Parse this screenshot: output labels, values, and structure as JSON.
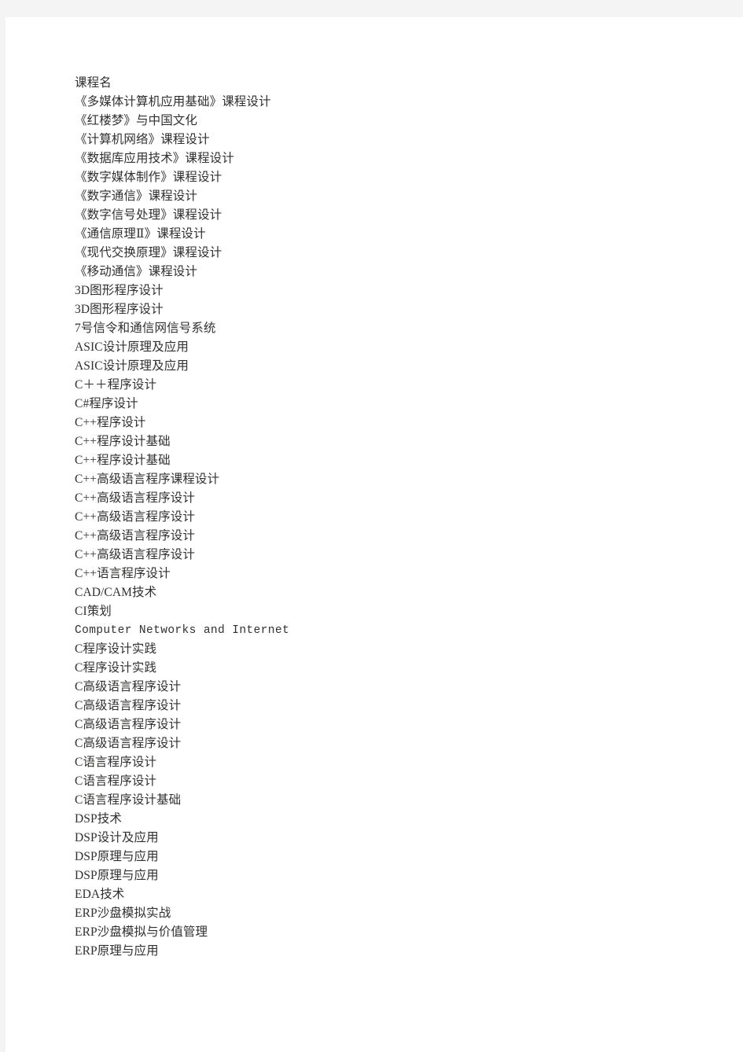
{
  "page": {
    "background_color": "#ffffff",
    "chrome_color": "#f4f4f4",
    "text_color": "#31302f"
  },
  "document": {
    "header": "课程名",
    "lines": [
      "《多媒体计算机应用基础》课程设计",
      "《红楼梦》与中国文化",
      "《计算机网络》课程设计",
      "《数据库应用技术》课程设计",
      "《数字媒体制作》课程设计",
      "《数字通信》课程设计",
      "《数字信号处理》课程设计",
      "《通信原理Ⅱ》课程设计",
      "《现代交换原理》课程设计",
      "《移动通信》课程设计",
      "3D图形程序设计",
      "3D图形程序设计",
      "7号信令和通信网信号系统",
      "ASIC设计原理及应用",
      "ASIC设计原理及应用",
      "C＋＋程序设计",
      "C#程序设计",
      "C++程序设计",
      "C++程序设计基础",
      "C++程序设计基础",
      "C++高级语言程序课程设计",
      "C++高级语言程序设计",
      "C++高级语言程序设计",
      "C++高级语言程序设计",
      "C++高级语言程序设计",
      "C++语言程序设计",
      "CAD/CAM技术",
      "CI策划",
      "Computer Networks and Internet",
      "C程序设计实践",
      "C程序设计实践",
      "C高级语言程序设计",
      "C高级语言程序设计",
      "C高级语言程序设计",
      "C高级语言程序设计",
      "C语言程序设计",
      "C语言程序设计",
      "C语言程序设计基础",
      "DSP技术",
      "DSP设计及应用",
      "DSP原理与应用",
      "DSP原理与应用",
      "EDA技术",
      "ERP沙盘模拟实战",
      "ERP沙盘模拟与价值管理",
      "ERP原理与应用"
    ],
    "mono_lines": [
      "Computer Networks and Internet"
    ]
  }
}
